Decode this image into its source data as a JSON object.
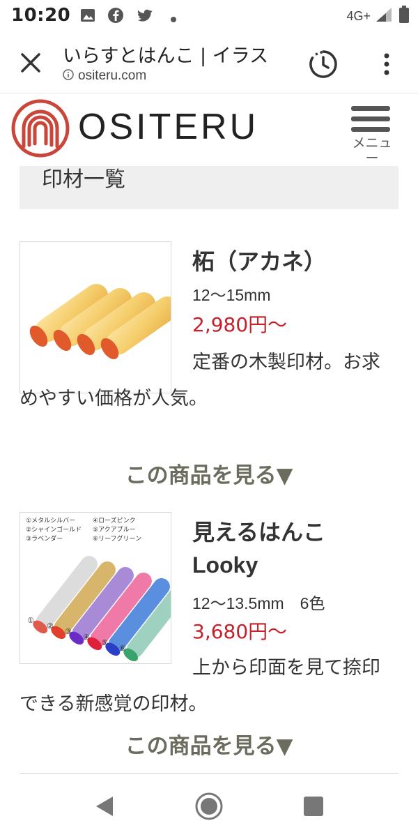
{
  "status_bar": {
    "time": "10:20",
    "icons": [
      "image-icon",
      "facebook-icon",
      "twitter-icon",
      "dot-icon"
    ],
    "network": "4G+",
    "right_icons": [
      "signal-icon",
      "battery-icon"
    ]
  },
  "browser": {
    "title": "いらすとはんこ | イラス",
    "url": "ositeru.com",
    "icons": [
      "close-icon",
      "info-icon",
      "history-icon",
      "more-vert-icon"
    ]
  },
  "site": {
    "logo_text": "OSITERU",
    "menu_label": "メニュー",
    "accent_color": "#c8463a"
  },
  "section": {
    "heading": "印材一覧"
  },
  "products": [
    {
      "name": "柘（アカネ）",
      "size": "12～15mm",
      "price": "2,980円～",
      "description": "定番の木製印材。お求めやすい価格が人気。",
      "link": "この商品を見る▼"
    },
    {
      "name": "見えるはんこ",
      "subname": "Looky",
      "size": "12～13.5mm　6色",
      "price": "3,680円～",
      "description": "上から印面を見て捺印できる新感覚の印材。",
      "link": "この商品を見る▼",
      "color_labels": [
        "①メタルシルバー",
        "②シャインゴールド",
        "③ラベンダー",
        "④ローズピンク",
        "⑤アクアブルー",
        "⑥リーフグリーン"
      ],
      "number_labels": [
        "①",
        "②",
        "③",
        "④",
        "⑤",
        "⑥"
      ]
    }
  ],
  "nav_bar": {
    "icons": [
      "back-icon",
      "home-icon",
      "recents-icon"
    ]
  },
  "colors": {
    "price_red": "#c8202a",
    "link_gray": "#6b6b5e",
    "heading_bg": "#efefef"
  }
}
